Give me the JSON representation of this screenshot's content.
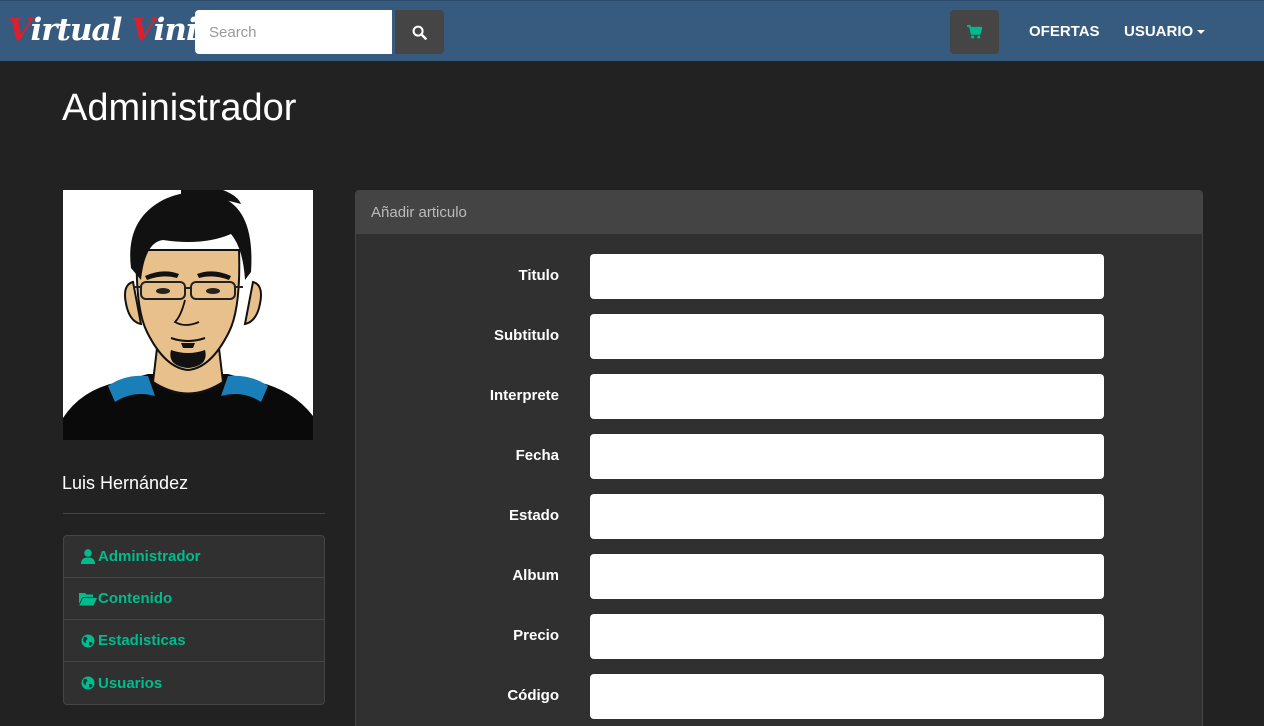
{
  "brand": {
    "cap1": "V",
    "rest1": "irtual ",
    "cap2": "V",
    "rest2": "inilo"
  },
  "navbar": {
    "search_placeholder": "Search",
    "search_icon": "search-icon",
    "cart_icon": "shopping-cart-icon",
    "ofertas_label": "OFERTAS",
    "usuario_label": "USUARIO",
    "accent_color": "#00bc8c",
    "bar_color": "#375a7f"
  },
  "page": {
    "title": "Administrador"
  },
  "profile": {
    "name": "Luis Hernández",
    "menu": [
      {
        "label": "Administrador",
        "icon": "user-icon"
      },
      {
        "label": "Contenido",
        "icon": "folder-open-icon"
      },
      {
        "label": "Estadisticas",
        "icon": "globe-icon"
      },
      {
        "label": "Usuarios",
        "icon": "globe-icon"
      }
    ]
  },
  "form": {
    "heading": "Añadir articulo",
    "fields": [
      {
        "label": "Titulo",
        "value": ""
      },
      {
        "label": "Subtitulo",
        "value": ""
      },
      {
        "label": "Interprete",
        "value": ""
      },
      {
        "label": "Fecha",
        "value": ""
      },
      {
        "label": "Estado",
        "value": ""
      },
      {
        "label": "Album",
        "value": ""
      },
      {
        "label": "Precio",
        "value": ""
      },
      {
        "label": "Código",
        "value": ""
      }
    ]
  }
}
